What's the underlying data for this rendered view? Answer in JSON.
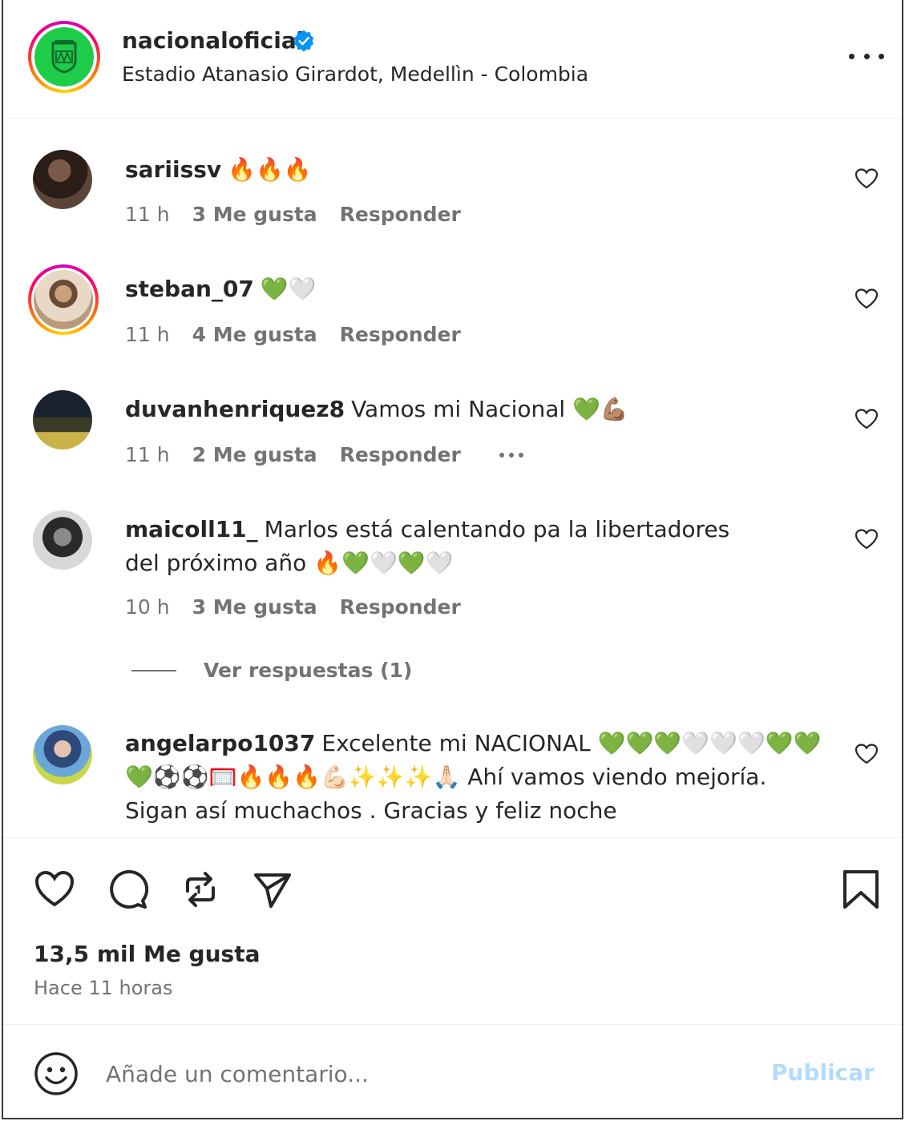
{
  "header": {
    "username": "nacionaloficial",
    "location": "Estadio Atanasio Girardot, Medellìn - Colombia"
  },
  "comments": [
    {
      "username": "sariissv",
      "text": "🔥🔥🔥",
      "time": "11 h",
      "likes": "3 Me gusta",
      "reply": "Responder"
    },
    {
      "username": "steban_07",
      "text": "💚🤍",
      "time": "11 h",
      "likes": "4 Me gusta",
      "reply": "Responder"
    },
    {
      "username": "duvanhenriquez8",
      "text": "Vamos mi Nacional 💚💪🏽",
      "time": "11 h",
      "likes": "2 Me gusta",
      "reply": "Responder"
    },
    {
      "username": "maicoll11_",
      "text": "Marlos está calentando pa la libertadores del próximo año 🔥💚🤍💚🤍",
      "time": "10 h",
      "likes": "3 Me gusta",
      "reply": "Responder"
    },
    {
      "username": "angelarpo1037",
      "text": "Excelente mi NACIONAL 💚💚💚🤍🤍🤍💚💚💚⚽⚽🥅🔥🔥🔥💪🏻✨✨✨🙏🏻 Ahí vamos viendo mejoría. Sigan así muchachos . Gracias y feliz noche"
    }
  ],
  "view_replies": "Ver respuestas (1)",
  "post": {
    "likes": "13,5 mil Me gusta",
    "time_ago": "Hace 11 horas"
  },
  "comment_bar": {
    "placeholder": "Añade un comentario...",
    "publish": "Publicar"
  },
  "icons": {
    "more": "more-horizontal-icon",
    "verified": "verified-badge-icon",
    "like": "heart-icon",
    "comment": "comment-icon",
    "repost": "repost-icon",
    "share": "send-icon",
    "save": "bookmark-icon",
    "emoji": "emoji-icon"
  },
  "colors": {
    "brand_green": "#00A94F",
    "verified_blue": "#0095F6",
    "publish_disabled": "#B3DBFF",
    "text_secondary": "#737373"
  }
}
